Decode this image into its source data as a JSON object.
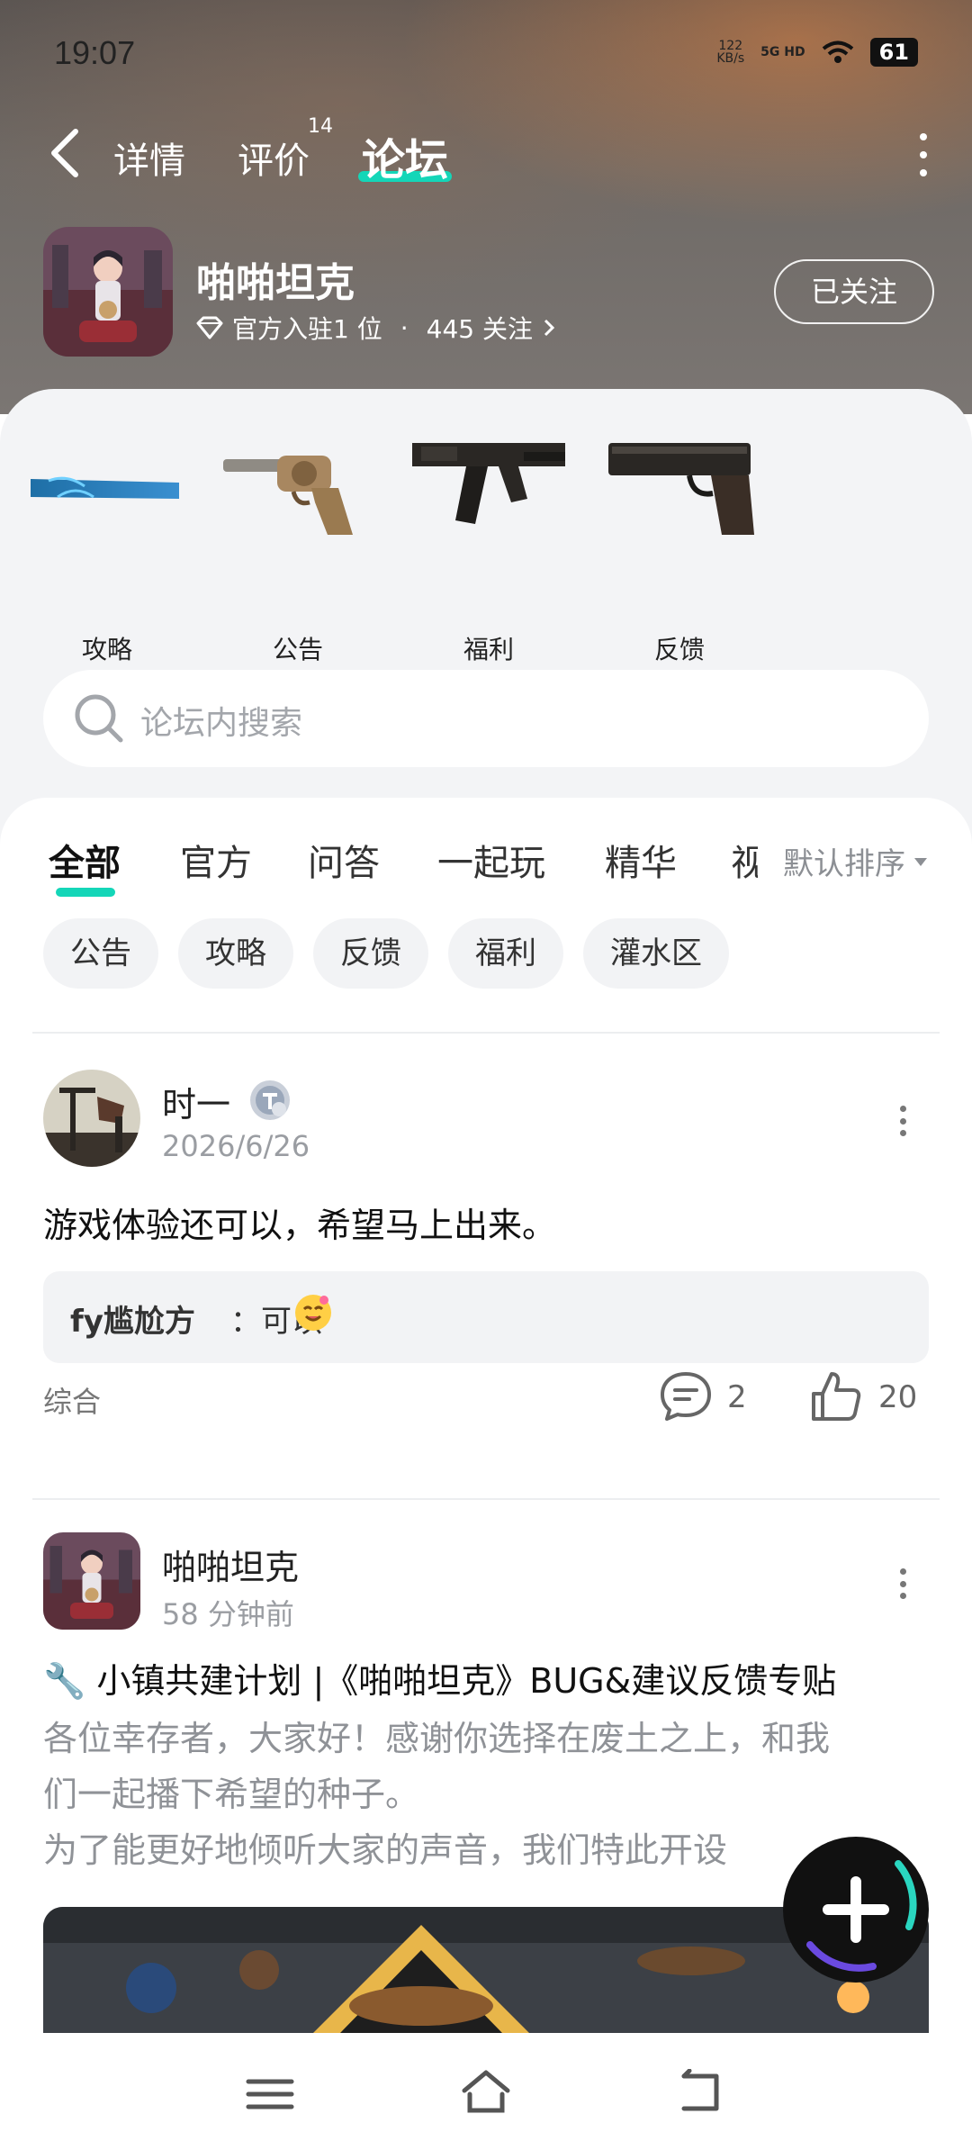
{
  "status_bar": {
    "time": "19:07",
    "net_speed_value": "122",
    "net_speed_unit": "KB/s",
    "signal": "5G HD",
    "battery": "61"
  },
  "nav": {
    "tabs": [
      {
        "label": "详情"
      },
      {
        "label": "评价",
        "badge": "14"
      },
      {
        "label": "论坛",
        "active": true
      }
    ]
  },
  "game": {
    "name": "啪啪坦克",
    "meta_official": "官方入驻1 位",
    "meta_sep": "·",
    "meta_follow": "445 关注",
    "follow_button": "已关注"
  },
  "categories": [
    {
      "label": "攻略",
      "icon": "bat-icon"
    },
    {
      "label": "公告",
      "icon": "revolver-icon"
    },
    {
      "label": "福利",
      "icon": "rifle-icon"
    },
    {
      "label": "反馈",
      "icon": "pistol-icon"
    }
  ],
  "search": {
    "placeholder": "论坛内搜索"
  },
  "feed": {
    "tabs": [
      "全部",
      "官方",
      "问答",
      "一起玩",
      "精华"
    ],
    "clipped_tab": "视",
    "sort": "默认排序",
    "chips": [
      "公告",
      "攻略",
      "反馈",
      "福利",
      "灌水区"
    ]
  },
  "posts": [
    {
      "author": "时一",
      "time": "2026/6/26",
      "text": "游戏体验还可以，希望马上出来。",
      "reply_name": "fy尴尬方",
      "reply_text": "：可以",
      "tag": "综合",
      "comments": "2",
      "likes": "20"
    },
    {
      "author": "啪啪坦克",
      "time": "58 分钟前",
      "title": "🔧 小镇共建计划 |《啪啪坦克》BUG&建议反馈专贴",
      "body_line1": "各位幸存者，大家好！感谢你选择在废土之上，和我",
      "body_line2": "们一起播下希望的种子。",
      "body_line3": "为了能更好地倾听大家的声音，我们特此开设"
    }
  ],
  "colors": {
    "accent": "#14d6b8",
    "sheet_bg": "#f3f4f6"
  }
}
